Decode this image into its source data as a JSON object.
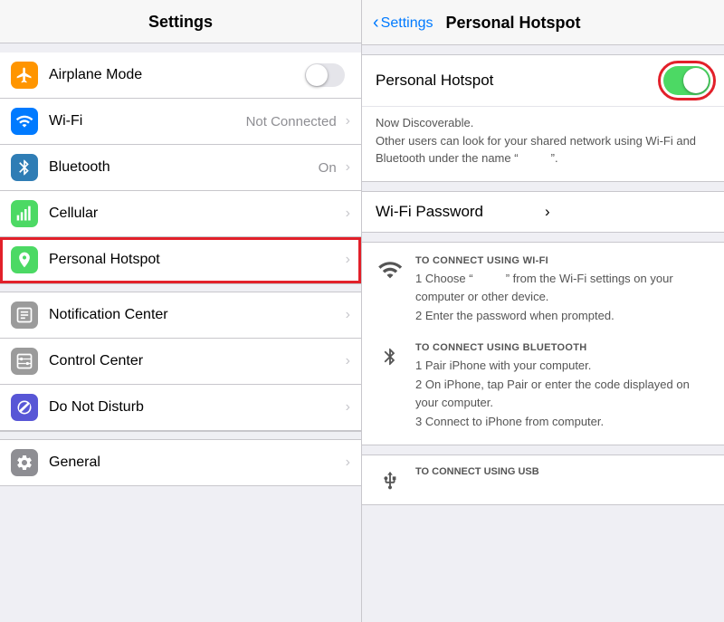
{
  "left": {
    "header": "Settings",
    "items": [
      {
        "id": "airplane",
        "label": "Airplane Mode",
        "iconBg": "#ff9500",
        "iconType": "airplane",
        "hasToggle": true,
        "value": "",
        "hasChevron": false
      },
      {
        "id": "wifi",
        "label": "Wi-Fi",
        "iconBg": "#007aff",
        "iconType": "wifi",
        "hasToggle": false,
        "value": "Not Connected",
        "hasChevron": true
      },
      {
        "id": "bluetooth",
        "label": "Bluetooth",
        "iconBg": "#2f7db5",
        "iconType": "bluetooth",
        "hasToggle": false,
        "value": "On",
        "hasChevron": true
      },
      {
        "id": "cellular",
        "label": "Cellular",
        "iconBg": "#4cd964",
        "iconType": "cellular",
        "hasToggle": false,
        "value": "",
        "hasChevron": true
      },
      {
        "id": "hotspot",
        "label": "Personal Hotspot",
        "iconBg": "#4cd964",
        "iconType": "hotspot",
        "hasToggle": false,
        "value": "",
        "hasChevron": true,
        "highlighted": true
      },
      {
        "id": "divider1"
      },
      {
        "id": "notification",
        "label": "Notification Center",
        "iconBg": "#9b9b9b",
        "iconType": "notification",
        "hasToggle": false,
        "value": "",
        "hasChevron": true
      },
      {
        "id": "controlcenter",
        "label": "Control Center",
        "iconBg": "#9b9b9b",
        "iconType": "controlcenter",
        "hasToggle": false,
        "value": "",
        "hasChevron": true
      },
      {
        "id": "donotdisturb",
        "label": "Do Not Disturb",
        "iconBg": "#5856d6",
        "iconType": "donotdisturb",
        "hasToggle": false,
        "value": "",
        "hasChevron": true
      },
      {
        "id": "divider2"
      },
      {
        "id": "general",
        "label": "General",
        "iconBg": "#8e8e93",
        "iconType": "general",
        "hasToggle": false,
        "value": "",
        "hasChevron": true
      }
    ]
  },
  "right": {
    "backLabel": "Settings",
    "title": "Personal Hotspot",
    "toggleLabel": "Personal Hotspot",
    "toggleOn": true,
    "discoverableText": "Now Discoverable.\nOther users can look for your shared network using Wi-Fi and Bluetooth under the name \"          \".",
    "wifiPasswordLabel": "Wi-Fi Password",
    "connectSections": [
      {
        "id": "wifi",
        "title": "TO CONNECT USING WI-FI",
        "steps": "1 Choose \"          \" from the\n   Wi-Fi settings on your computer or\n   other device.\n2 Enter the password when prompted."
      },
      {
        "id": "bluetooth",
        "title": "TO CONNECT USING BLUETOOTH",
        "steps": "1 Pair iPhone with your computer.\n2 On iPhone, tap Pair or enter the\n   code displayed on your computer.\n3 Connect to iPhone from computer."
      }
    ],
    "usbTitle": "TO CONNECT USING USB"
  }
}
